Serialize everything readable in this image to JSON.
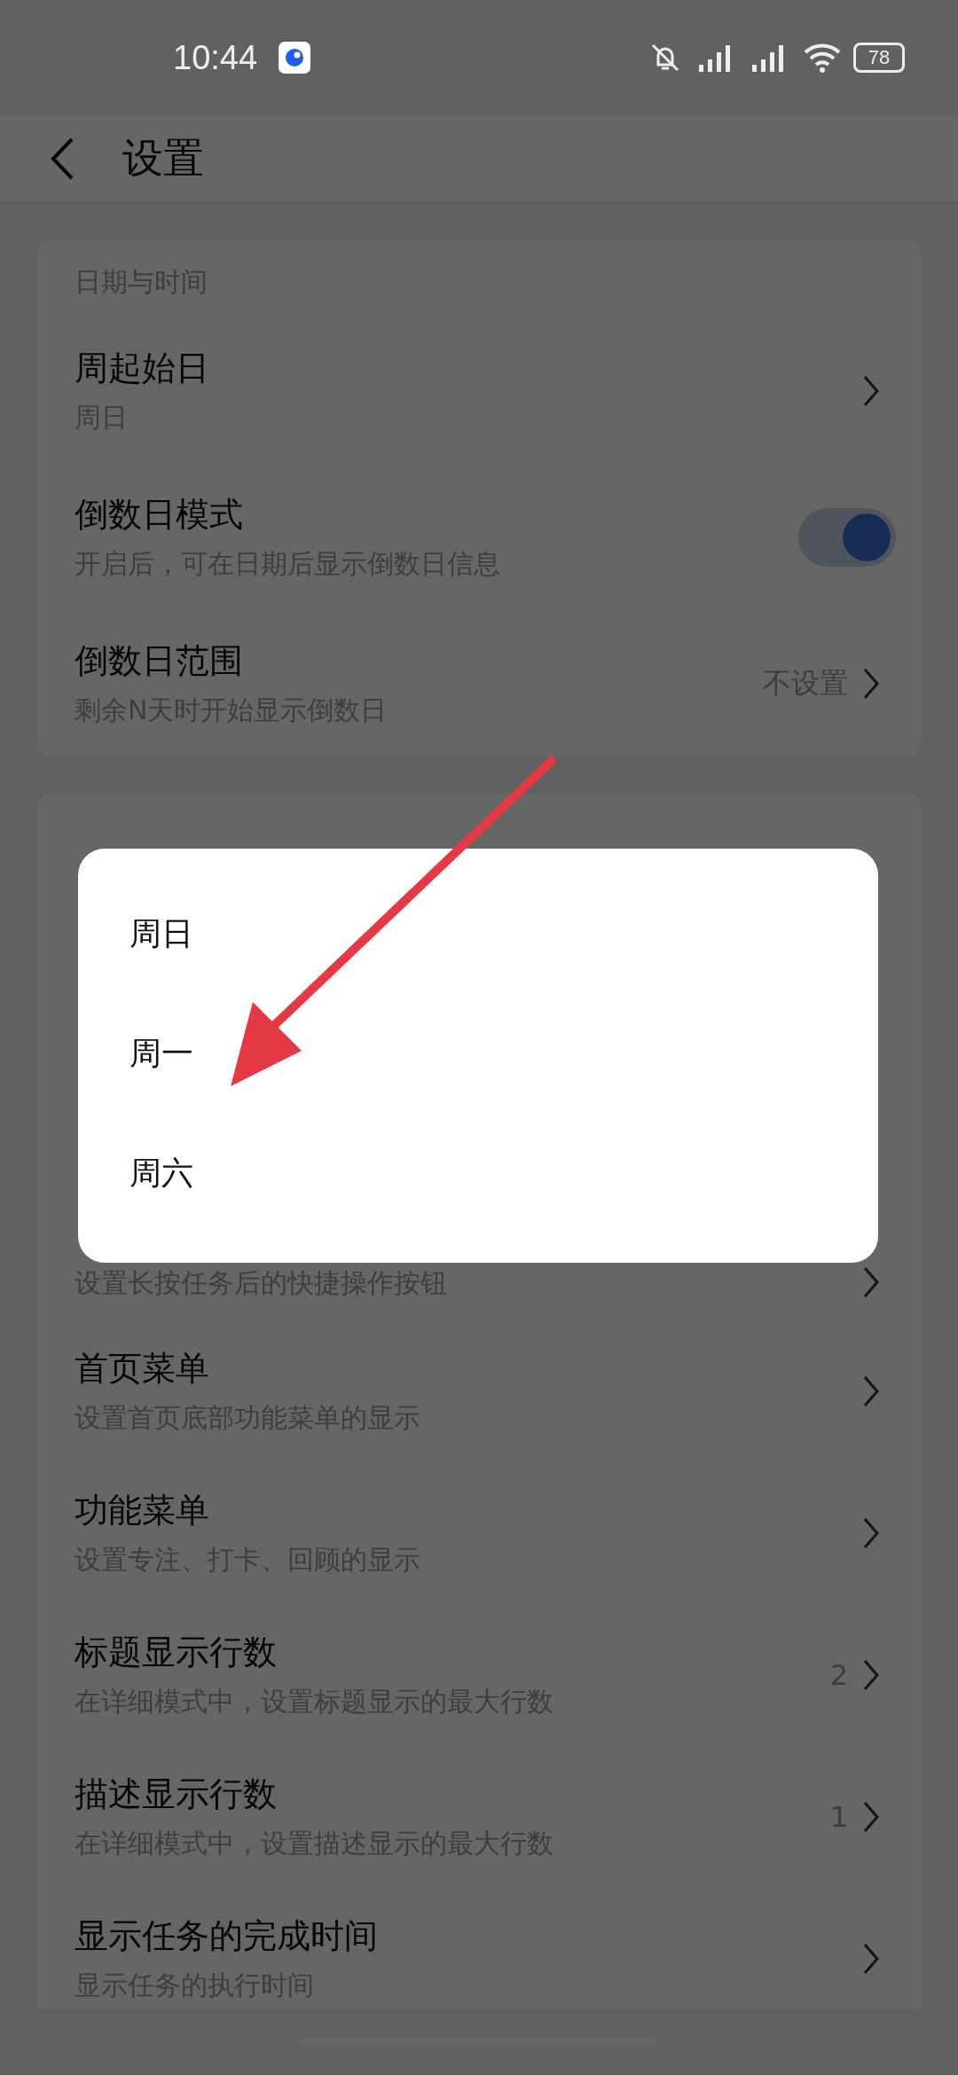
{
  "status_bar": {
    "time": "10:44",
    "battery": "78"
  },
  "header": {
    "title": "设置"
  },
  "sections": [
    {
      "title": "日期与时间",
      "rows": [
        {
          "kind": "chevron",
          "title": "周起始日",
          "subtitle": "周日"
        },
        {
          "kind": "toggle",
          "title": "倒数日模式",
          "subtitle": "开启后，可在日期后显示倒数日信息",
          "on": true
        },
        {
          "kind": "chevron",
          "title": "倒数日范围",
          "subtitle": "剩余N天时开始显示倒数日",
          "value": "不设置"
        }
      ]
    },
    {
      "rows": [
        {
          "kind": "chevron",
          "subtitle": "设置长按任务后的快捷操作按钮"
        },
        {
          "kind": "chevron",
          "title": "首页菜单",
          "subtitle": "设置首页底部功能菜单的显示"
        },
        {
          "kind": "chevron",
          "title": "功能菜单",
          "subtitle": "设置专注、打卡、回顾的显示"
        },
        {
          "kind": "chevron",
          "title": "标题显示行数",
          "subtitle": "在详细模式中，设置标题显示的最大行数",
          "value": "2"
        },
        {
          "kind": "chevron",
          "title": "描述显示行数",
          "subtitle": "在详细模式中，设置描述显示的最大行数",
          "value": "1"
        },
        {
          "kind": "chevron",
          "title": "显示任务的完成时间",
          "subtitle": "显示任务的执行时间"
        }
      ]
    }
  ],
  "dialog": {
    "options": [
      "周日",
      "周一",
      "周六"
    ]
  }
}
